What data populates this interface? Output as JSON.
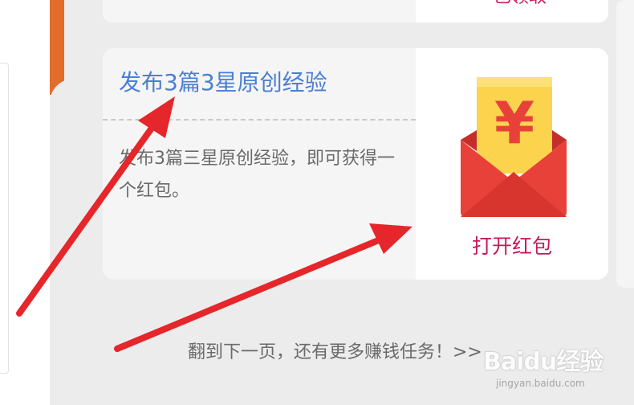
{
  "top_card": {
    "label": "已领取"
  },
  "task": {
    "title": "发布3篇3星原创经验",
    "description": "发布3篇三星原创经验，即可获得一个红包。",
    "reward": {
      "icon": "red-envelope-yuan-icon",
      "symbol": "¥",
      "action_label": "打开红包"
    }
  },
  "footer": {
    "hint": "翻到下一页，还有更多赚钱任务！>>"
  },
  "watermark": {
    "brand": "Baidu经验",
    "url": "jingyan.baidu.com"
  },
  "colors": {
    "accent_orange": "#e26d2b",
    "title_blue": "#4a7fd4",
    "action_red": "#c41a5a",
    "arrow_red": "#e5262b",
    "envelope_red": "#e8413a",
    "envelope_yellow": "#fbd34d"
  }
}
